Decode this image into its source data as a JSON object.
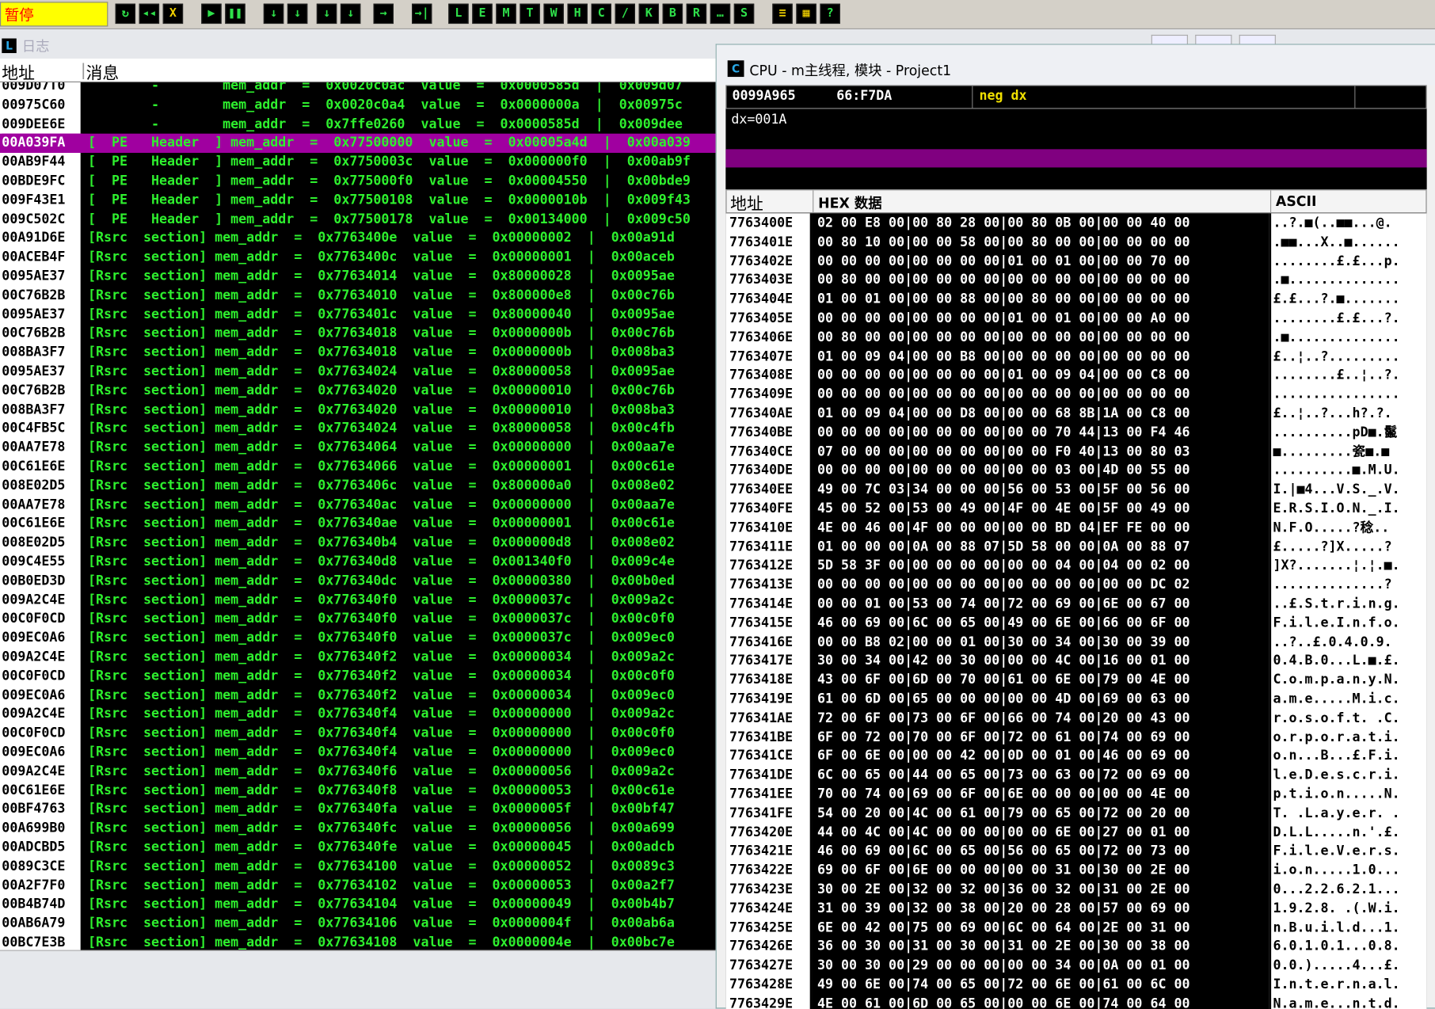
{
  "toolbar": {
    "status": "暂停",
    "buttons": [
      "↻",
      "◂◂",
      "X",
      "▶",
      "❚❚",
      "↓",
      "↓",
      "↓",
      "↓",
      "→",
      "→|",
      "L",
      "E",
      "M",
      "T",
      "W",
      "H",
      "C",
      "/",
      "K",
      "B",
      "R",
      "…",
      "S",
      "≡",
      "▦",
      "?"
    ]
  },
  "log_window": {
    "title": "日志",
    "col_addr": "地址",
    "col_msg": "消息",
    "rows": [
      {
        "addr": "009D07T0",
        "msg": "        -        mem_addr  =  0x0020c0ac  value  =  0x0000585d  |  0x009d07"
      },
      {
        "addr": "00975C60",
        "msg": "        -        mem_addr  =  0x0020c0a4  value  =  0x0000000a  |  0x00975c"
      },
      {
        "addr": "009DEE6E",
        "msg": "        -        mem_addr  =  0x7ffe0260  value  =  0x0000585d  |  0x009dee"
      },
      {
        "addr": "00A039FA",
        "msg": "[  PE   Header  ] mem_addr  =  0x77500000  value  =  0x00005a4d  |  0x00a039",
        "selected": true
      },
      {
        "addr": "00AB9F44",
        "msg": "[  PE   Header  ] mem_addr  =  0x7750003c  value  =  0x000000f0  |  0x00ab9f"
      },
      {
        "addr": "00BDE9FC",
        "msg": "[  PE   Header  ] mem_addr  =  0x775000f0  value  =  0x00004550  |  0x00bde9"
      },
      {
        "addr": "009F43E1",
        "msg": "[  PE   Header  ] mem_addr  =  0x77500108  value  =  0x0000010b  |  0x009f43"
      },
      {
        "addr": "009C502C",
        "msg": "[  PE   Header  ] mem_addr  =  0x77500178  value  =  0x00134000  |  0x009c50"
      },
      {
        "addr": "00A91D6E",
        "msg": "[Rsrc  section] mem_addr  =  0x7763400e  value  =  0x00000002  |  0x00a91d"
      },
      {
        "addr": "00ACEB4F",
        "msg": "[Rsrc  section] mem_addr  =  0x7763400c  value  =  0x00000001  |  0x00aceb"
      },
      {
        "addr": "0095AE37",
        "msg": "[Rsrc  section] mem_addr  =  0x77634014  value  =  0x80000028  |  0x0095ae"
      },
      {
        "addr": "00C76B2B",
        "msg": "[Rsrc  section] mem_addr  =  0x77634010  value  =  0x800000e8  |  0x00c76b"
      },
      {
        "addr": "0095AE37",
        "msg": "[Rsrc  section] mem_addr  =  0x7763401c  value  =  0x80000040  |  0x0095ae"
      },
      {
        "addr": "00C76B2B",
        "msg": "[Rsrc  section] mem_addr  =  0x77634018  value  =  0x0000000b  |  0x00c76b"
      },
      {
        "addr": "008BA3F7",
        "msg": "[Rsrc  section] mem_addr  =  0x77634018  value  =  0x0000000b  |  0x008ba3"
      },
      {
        "addr": "0095AE37",
        "msg": "[Rsrc  section] mem_addr  =  0x77634024  value  =  0x80000058  |  0x0095ae"
      },
      {
        "addr": "00C76B2B",
        "msg": "[Rsrc  section] mem_addr  =  0x77634020  value  =  0x00000010  |  0x00c76b"
      },
      {
        "addr": "008BA3F7",
        "msg": "[Rsrc  section] mem_addr  =  0x77634020  value  =  0x00000010  |  0x008ba3"
      },
      {
        "addr": "00C4FB5C",
        "msg": "[Rsrc  section] mem_addr  =  0x77634024  value  =  0x80000058  |  0x00c4fb"
      },
      {
        "addr": "00AA7E78",
        "msg": "[Rsrc  section] mem_addr  =  0x77634064  value  =  0x00000000  |  0x00aa7e"
      },
      {
        "addr": "00C61E6E",
        "msg": "[Rsrc  section] mem_addr  =  0x77634066  value  =  0x00000001  |  0x00c61e"
      },
      {
        "addr": "008E02D5",
        "msg": "[Rsrc  section] mem_addr  =  0x7763406c  value  =  0x800000a0  |  0x008e02"
      },
      {
        "addr": "00AA7E78",
        "msg": "[Rsrc  section] mem_addr  =  0x776340ac  value  =  0x00000000  |  0x00aa7e"
      },
      {
        "addr": "00C61E6E",
        "msg": "[Rsrc  section] mem_addr  =  0x776340ae  value  =  0x00000001  |  0x00c61e"
      },
      {
        "addr": "008E02D5",
        "msg": "[Rsrc  section] mem_addr  =  0x776340b4  value  =  0x000000d8  |  0x008e02"
      },
      {
        "addr": "009C4E55",
        "msg": "[Rsrc  section] mem_addr  =  0x776340d8  value  =  0x001340f0  |  0x009c4e"
      },
      {
        "addr": "00B0ED3D",
        "msg": "[Rsrc  section] mem_addr  =  0x776340dc  value  =  0x00000380  |  0x00b0ed"
      },
      {
        "addr": "009A2C4E",
        "msg": "[Rsrc  section] mem_addr  =  0x776340f0  value  =  0x0000037c  |  0x009a2c"
      },
      {
        "addr": "00C0F0CD",
        "msg": "[Rsrc  section] mem_addr  =  0x776340f0  value  =  0x0000037c  |  0x00c0f0"
      },
      {
        "addr": "009EC0A6",
        "msg": "[Rsrc  section] mem_addr  =  0x776340f0  value  =  0x0000037c  |  0x009ec0"
      },
      {
        "addr": "009A2C4E",
        "msg": "[Rsrc  section] mem_addr  =  0x776340f2  value  =  0x00000034  |  0x009a2c"
      },
      {
        "addr": "00C0F0CD",
        "msg": "[Rsrc  section] mem_addr  =  0x776340f2  value  =  0x00000034  |  0x00c0f0"
      },
      {
        "addr": "009EC0A6",
        "msg": "[Rsrc  section] mem_addr  =  0x776340f2  value  =  0x00000034  |  0x009ec0"
      },
      {
        "addr": "009A2C4E",
        "msg": "[Rsrc  section] mem_addr  =  0x776340f4  value  =  0x00000000  |  0x009a2c"
      },
      {
        "addr": "00C0F0CD",
        "msg": "[Rsrc  section] mem_addr  =  0x776340f4  value  =  0x00000000  |  0x00c0f0"
      },
      {
        "addr": "009EC0A6",
        "msg": "[Rsrc  section] mem_addr  =  0x776340f4  value  =  0x00000000  |  0x009ec0"
      },
      {
        "addr": "009A2C4E",
        "msg": "[Rsrc  section] mem_addr  =  0x776340f6  value  =  0x00000056  |  0x009a2c"
      },
      {
        "addr": "00C61E6E",
        "msg": "[Rsrc  section] mem_addr  =  0x776340f8  value  =  0x00000053  |  0x00c61e"
      },
      {
        "addr": "00BF4763",
        "msg": "[Rsrc  section] mem_addr  =  0x776340fa  value  =  0x0000005f  |  0x00bf47"
      },
      {
        "addr": "00A699B0",
        "msg": "[Rsrc  section] mem_addr  =  0x776340fc  value  =  0x00000056  |  0x00a699"
      },
      {
        "addr": "00ADCBD5",
        "msg": "[Rsrc  section] mem_addr  =  0x776340fe  value  =  0x00000045  |  0x00adcb"
      },
      {
        "addr": "0089C3CE",
        "msg": "[Rsrc  section] mem_addr  =  0x77634100  value  =  0x00000052  |  0x0089c3"
      },
      {
        "addr": "00A2F7F0",
        "msg": "[Rsrc  section] mem_addr  =  0x77634102  value  =  0x00000053  |  0x00a2f7"
      },
      {
        "addr": "00B4B74D",
        "msg": "[Rsrc  section] mem_addr  =  0x77634104  value  =  0x00000049  |  0x00b4b7"
      },
      {
        "addr": "00AB6A79",
        "msg": "[Rsrc  section] mem_addr  =  0x77634106  value  =  0x0000004f  |  0x00ab6a"
      },
      {
        "addr": "00BC7E3B",
        "msg": "[Rsrc  section] mem_addr  =  0x77634108  value  =  0x0000004e  |  0x00bc7e"
      }
    ]
  },
  "cpu_window": {
    "title": "CPU - m主线程, 模块 - Project1",
    "disasm": {
      "addr": "0099A965",
      "bytes": "66:F7DA",
      "instr": "neg dx"
    },
    "info": "dx=001A",
    "col_addr": "地址",
    "col_hex": "HEX 数据",
    "col_ascii": "ASCII",
    "hex_rows": [
      {
        "addr": "7763400E",
        "hex": "02 00 E8 00|00 80 28 00|00 80 0B 00|00 00 40 00",
        "ascii": "..?.■(..■■...@."
      },
      {
        "addr": "7763401E",
        "hex": "00 80 10 00|00 00 58 00|00 80 00 00|00 00 00 00",
        "ascii": ".■■...X..■......"
      },
      {
        "addr": "7763402E",
        "hex": "00 00 00 00|00 00 00 00|01 00 01 00|00 00 70 00",
        "ascii": "........£.£...p."
      },
      {
        "addr": "7763403E",
        "hex": "00 80 00 00|00 00 00 00|00 00 00 00|00 00 00 00",
        "ascii": ".■.............."
      },
      {
        "addr": "7763404E",
        "hex": "01 00 01 00|00 00 88 00|00 80 00 00|00 00 00 00",
        "ascii": "£.£...?.■......."
      },
      {
        "addr": "7763405E",
        "hex": "00 00 00 00|00 00 00 00|01 00 01 00|00 00 A0 00",
        "ascii": "........£.£...?."
      },
      {
        "addr": "7763406E",
        "hex": "00 80 00 00|00 00 00 00|00 00 00 00|00 00 00 00",
        "ascii": ".■.............."
      },
      {
        "addr": "7763407E",
        "hex": "01 00 09 04|00 00 B8 00|00 00 00 00|00 00 00 00",
        "ascii": "£..¦..?........."
      },
      {
        "addr": "7763408E",
        "hex": "00 00 00 00|00 00 00 00|01 00 09 04|00 00 C8 00",
        "ascii": "........£..¦..?."
      },
      {
        "addr": "7763409E",
        "hex": "00 00 00 00|00 00 00 00|00 00 00 00|00 00 00 00",
        "ascii": "................"
      },
      {
        "addr": "776340AE",
        "hex": "01 00 09 04|00 00 D8 00|00 00 68 8B|1A 00 C8 00",
        "ascii": "£..¦..?...h?.?."
      },
      {
        "addr": "776340BE",
        "hex": "00 00 00 00|00 00 00 00|00 00 70 44|13 00 F4 46",
        "ascii": "..........pD■.鬣"
      },
      {
        "addr": "776340CE",
        "hex": "07 00 00 00|00 00 00 00|00 00 F0 40|13 00 80 03",
        "ascii": "■.........瓷■.■"
      },
      {
        "addr": "776340DE",
        "hex": "00 00 00 00|00 00 00 00|00 00 03 00|4D 00 55 00",
        "ascii": "..........■.M.U."
      },
      {
        "addr": "776340EE",
        "hex": "49 00 7C 03|34 00 00 00|56 00 53 00|5F 00 56 00",
        "ascii": "I.|■4...V.S._.V."
      },
      {
        "addr": "776340FE",
        "hex": "45 00 52 00|53 00 49 00|4F 00 4E 00|5F 00 49 00",
        "ascii": "E.R.S.I.O.N._.I."
      },
      {
        "addr": "7763410E",
        "hex": "4E 00 46 00|4F 00 00 00|00 00 BD 04|EF FE 00 00",
        "ascii": "N.F.O.....?稔.."
      },
      {
        "addr": "7763411E",
        "hex": "01 00 00 00|0A 00 88 07|5D 58 00 00|0A 00 88 07",
        "ascii": "£.....?]X.....?"
      },
      {
        "addr": "7763412E",
        "hex": "5D 58 3F 00|00 00 00 00|00 00 04 00|04 00 02 00",
        "ascii": "]X?.......¦.¦.■."
      },
      {
        "addr": "7763413E",
        "hex": "00 00 00 00|00 00 00 00|00 00 00 00|00 00 DC 02",
        "ascii": "..............?"
      },
      {
        "addr": "7763414E",
        "hex": "00 00 01 00|53 00 74 00|72 00 69 00|6E 00 67 00",
        "ascii": "..£.S.t.r.i.n.g."
      },
      {
        "addr": "7763415E",
        "hex": "46 00 69 00|6C 00 65 00|49 00 6E 00|66 00 6F 00",
        "ascii": "F.i.l.e.I.n.f.o."
      },
      {
        "addr": "7763416E",
        "hex": "00 00 B8 02|00 00 01 00|30 00 34 00|30 00 39 00",
        "ascii": "..?..£.0.4.0.9."
      },
      {
        "addr": "7763417E",
        "hex": "30 00 34 00|42 00 30 00|00 00 4C 00|16 00 01 00",
        "ascii": "0.4.B.0...L.■.£."
      },
      {
        "addr": "7763418E",
        "hex": "43 00 6F 00|6D 00 70 00|61 00 6E 00|79 00 4E 00",
        "ascii": "C.o.m.p.a.n.y.N."
      },
      {
        "addr": "7763419E",
        "hex": "61 00 6D 00|65 00 00 00|00 00 4D 00|69 00 63 00",
        "ascii": "a.m.e.....M.i.c."
      },
      {
        "addr": "776341AE",
        "hex": "72 00 6F 00|73 00 6F 00|66 00 74 00|20 00 43 00",
        "ascii": "r.o.s.o.f.t. .C."
      },
      {
        "addr": "776341BE",
        "hex": "6F 00 72 00|70 00 6F 00|72 00 61 00|74 00 69 00",
        "ascii": "o.r.p.o.r.a.t.i."
      },
      {
        "addr": "776341CE",
        "hex": "6F 00 6E 00|00 00 42 00|0D 00 01 00|46 00 69 00",
        "ascii": "o.n...B...£.F.i."
      },
      {
        "addr": "776341DE",
        "hex": "6C 00 65 00|44 00 65 00|73 00 63 00|72 00 69 00",
        "ascii": "l.e.D.e.s.c.r.i."
      },
      {
        "addr": "776341EE",
        "hex": "70 00 74 00|69 00 6F 00|6E 00 00 00|00 00 4E 00",
        "ascii": "p.t.i.o.n.....N."
      },
      {
        "addr": "776341FE",
        "hex": "54 00 20 00|4C 00 61 00|79 00 65 00|72 00 20 00",
        "ascii": "T. .L.a.y.e.r. ."
      },
      {
        "addr": "7763420E",
        "hex": "44 00 4C 00|4C 00 00 00|00 00 6E 00|27 00 01 00",
        "ascii": "D.L.L.....n.'.£."
      },
      {
        "addr": "7763421E",
        "hex": "46 00 69 00|6C 00 65 00|56 00 65 00|72 00 73 00",
        "ascii": "F.i.l.e.V.e.r.s."
      },
      {
        "addr": "7763422E",
        "hex": "69 00 6F 00|6E 00 00 00|00 00 31 00|30 00 2E 00",
        "ascii": "i.o.n.....1.0..."
      },
      {
        "addr": "7763423E",
        "hex": "30 00 2E 00|32 00 32 00|36 00 32 00|31 00 2E 00",
        "ascii": "0...2.2.6.2.1..."
      },
      {
        "addr": "7763424E",
        "hex": "31 00 39 00|32 00 38 00|20 00 28 00|57 00 69 00",
        "ascii": "1.9.2.8. .(.W.i."
      },
      {
        "addr": "7763425E",
        "hex": "6E 00 42 00|75 00 69 00|6C 00 64 00|2E 00 31 00",
        "ascii": "n.B.u.i.l.d...1."
      },
      {
        "addr": "7763426E",
        "hex": "36 00 30 00|31 00 30 00|31 00 2E 00|30 00 38 00",
        "ascii": "6.0.1.0.1...0.8."
      },
      {
        "addr": "7763427E",
        "hex": "30 00 30 00|29 00 00 00|00 00 34 00|0A 00 01 00",
        "ascii": "0.0.).....4...£."
      },
      {
        "addr": "7763428E",
        "hex": "49 00 6E 00|74 00 65 00|72 00 6E 00|61 00 6C 00",
        "ascii": "I.n.t.e.r.n.a.l."
      },
      {
        "addr": "7763429E",
        "hex": "4E 00 61 00|6D 00 65 00|00 00 6E 00|74 00 64 00",
        "ascii": "N.a.m.e...n.t.d."
      }
    ]
  }
}
